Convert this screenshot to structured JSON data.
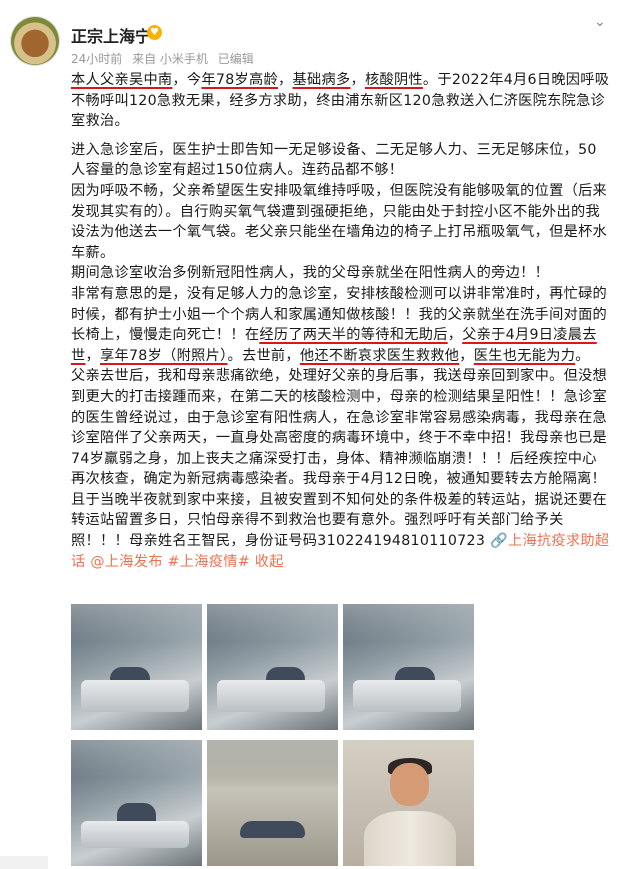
{
  "post": {
    "user_name": "正宗上海宁",
    "badge_icon": "fire-badge-icon",
    "meta": {
      "time": "24小时前",
      "source": "来自 小米手机",
      "edited": "已编辑"
    },
    "more_icon": "chevron-down-icon"
  },
  "content": {
    "p1_s1": "本人父亲吴中南",
    "p1_s2": "，今",
    "p1_s3": "年78岁高龄",
    "p1_s4": "，",
    "p1_s5": "基础病多",
    "p1_s6": "，",
    "p1_s7": "核酸阴性",
    "p1_s8": "。于2022年4月6日晚因呼吸不畅呼叫120急救无果，经多方求助，终由浦东新区120急救送入仁济医院东院急诊室救治。",
    "p2": "进入急诊室后，医生护士即告知一无足够设备、二无足够人力、三无足够床位，50人容量的急诊室有超过150位病人。连药品都不够！",
    "p3": "因为呼吸不畅，父亲希望医生安排吸氧维持呼吸，但医院没有能够吸氧的位置（后来发现其实有的）。自行购买氧气袋遭到强硬拒绝，只能由处于封控小区不能外出的我设法为他送去一个氧气袋。老父亲只能坐在墙角边的椅子上打吊瓶吸氧气，但是杯水车薪。",
    "p4": "期间急诊室收治多例新冠阳性病人，我的父母亲就坐在阳性病人的旁边！！",
    "p5_s1": "非常有意思的是，没有足够人力的急诊室，安排核酸检测可以讲非常准时，再忙碌的时候，都有护士小姐一个个病人和家属通知做核酸！！我的父亲就坐在洗手间对面的长椅上，慢慢走向死亡！！在",
    "p5_s2": "经历了两天半的等待和无助后",
    "p5_s3": "，",
    "p5_s4": "父亲于4月9日凌晨去世",
    "p5_s5": "，",
    "p5_s6": "享年78岁（附照片）",
    "p5_s7": "。去世前，",
    "p5_s8": "他还不断哀求医生救救他",
    "p5_s9": "，",
    "p5_s10": "医生也无能为力",
    "p5_s11": "。",
    "p6": "父亲去世后，我和母亲悲痛欲绝，处理好父亲的身后事，我送母亲回到家中。但没想到更大的打击接踵而来，在第二天的核酸检测中，母亲的检测结果呈阳性！！急诊室的医生曾经说过，由于急诊室有阳性病人，在急诊室非常容易感染病毒，我母亲在急诊室陪伴了父亲两天，一直身处高密度的病毒环境中，终于不幸中招！我母亲也已是74岁羸弱之身，加上丧夫之痛深受打击，身体、精神濒临崩溃！！！后经疾控中心再次核查，确定为新冠病毒感染者。我母亲于4月12日晚，被通知要转去方舱隔离！且于当晚半夜就到家中来接，且被安置到不知何处的条件极差的转运站，据说还要在转运站留置多日，只怕母亲得不到救治也要有意外。强烈呼吁有关部门给予关照！！！母亲姓名王智民，身份证号码310224194810110723",
    "tag_icon": "link-icon",
    "tag1": "上海抗疫求助超话",
    "tag2": "@上海发布",
    "tag3": "#上海疫情#",
    "collapse": "收起"
  },
  "photos": [
    {
      "name": "photo-1",
      "desc_icon": "photo-icon"
    },
    {
      "name": "photo-2",
      "desc_icon": "photo-icon"
    },
    {
      "name": "photo-3",
      "desc_icon": "photo-icon"
    },
    {
      "name": "photo-4",
      "desc_icon": "photo-icon"
    },
    {
      "name": "photo-5",
      "desc_icon": "photo-icon"
    },
    {
      "name": "photo-6",
      "desc_icon": "photo-icon"
    },
    {
      "name": "photo-7",
      "desc_icon": "photo-icon"
    },
    {
      "name": "photo-8",
      "desc_icon": "photo-icon"
    },
    {
      "name": "photo-9",
      "desc_icon": "photo-icon"
    }
  ],
  "colors": {
    "link": "#eb7350",
    "underline": "#d9161c",
    "meta": "#999999"
  }
}
